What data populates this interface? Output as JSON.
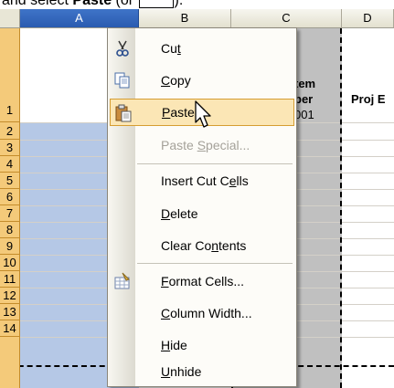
{
  "caption": {
    "prefix": "and select ",
    "bold": "Paste",
    "suffix": " (or ",
    "end": ")."
  },
  "columns": [
    "A",
    "B",
    "C",
    "D"
  ],
  "rows": [
    "1",
    "2",
    "3",
    "4",
    "5",
    "6",
    "7",
    "8",
    "9",
    "10",
    "11",
    "12",
    "13",
    "14"
  ],
  "cells": {
    "c1_line1": "tem",
    "c1_line2": "ber",
    "c2": "001",
    "d1": "Proj E"
  },
  "menu": {
    "items": [
      {
        "label_pre": "Cu",
        "label_ul": "t",
        "label_post": "",
        "icon": "scissors-icon"
      },
      {
        "label_pre": "",
        "label_ul": "C",
        "label_post": "opy",
        "icon": "copy-icon"
      },
      {
        "label_pre": "",
        "label_ul": "P",
        "label_post": "aste",
        "icon": "paste-icon"
      },
      {
        "label_pre": "Paste ",
        "label_ul": "S",
        "label_post": "pecial...",
        "icon": ""
      },
      {
        "label_pre": "Insert Cut C",
        "label_ul": "e",
        "label_post": "lls",
        "icon": ""
      },
      {
        "label_pre": "",
        "label_ul": "D",
        "label_post": "elete",
        "icon": ""
      },
      {
        "label_pre": "Clear Co",
        "label_ul": "n",
        "label_post": "tents",
        "icon": ""
      },
      {
        "label_pre": "",
        "label_ul": "F",
        "label_post": "ormat Cells...",
        "icon": "format-cells-icon"
      },
      {
        "label_pre": "",
        "label_ul": "C",
        "label_post": "olumn Width...",
        "icon": ""
      },
      {
        "label_pre": "",
        "label_ul": "H",
        "label_post": "ide",
        "icon": ""
      },
      {
        "label_pre": "",
        "label_ul": "U",
        "label_post": "nhide",
        "icon": ""
      }
    ],
    "hovered": "Paste",
    "disabled": "Paste Special..."
  },
  "colors": {
    "selected_header": "#2a5bb0",
    "selection_fill": "#b5c8e6",
    "row_header": "#f4ca7a",
    "hover_fill": "#fbe6b5",
    "hover_border": "#d69d31"
  }
}
